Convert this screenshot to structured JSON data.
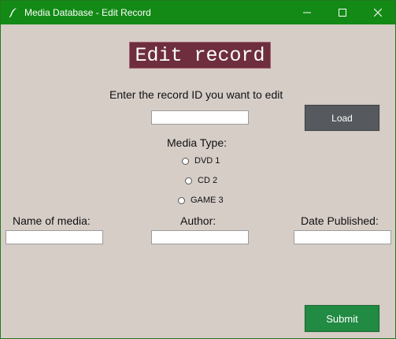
{
  "window": {
    "title": "Media Database - Edit Record",
    "app_icon": "feather-icon",
    "controls": [
      "minimize-icon",
      "maximize-icon",
      "close-icon"
    ]
  },
  "heading": "Edit record",
  "record_id": {
    "prompt": "Enter the record ID you want to edit",
    "value": "",
    "load_label": "Load"
  },
  "media_type": {
    "label": "Media Type:",
    "options": [
      {
        "label": "DVD 1",
        "selected": false
      },
      {
        "label": "CD 2",
        "selected": false
      },
      {
        "label": "GAME 3",
        "selected": false
      }
    ]
  },
  "fields": {
    "name_label": "Name of media:",
    "name_value": "",
    "author_label": "Author:",
    "author_value": "",
    "date_label": "Date Published:",
    "date_value": ""
  },
  "submit_label": "Submit",
  "colors": {
    "titlebar": "#138a16",
    "background": "#d6cdc7",
    "heading_bg": "#6e2e3e",
    "load_button": "#565a5e",
    "submit_button": "#218a43"
  }
}
